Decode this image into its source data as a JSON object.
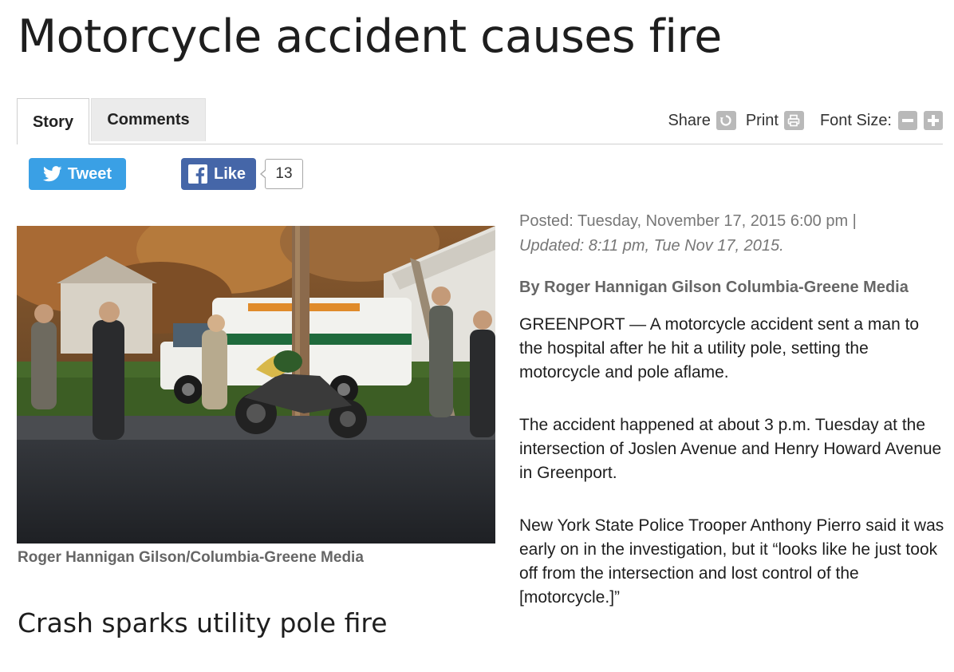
{
  "headline": "Motorcycle accident causes fire",
  "tabs": [
    {
      "label": "Story"
    },
    {
      "label": "Comments"
    }
  ],
  "toolbar": {
    "share_label": "Share",
    "print_label": "Print",
    "font_size_label": "Font Size:"
  },
  "social": {
    "tweet_label": "Tweet",
    "like_label": "Like",
    "like_count": "13"
  },
  "photo": {
    "caption": "Roger Hannigan Gilson/Columbia-Greene Media"
  },
  "subheadline": "Crash sparks utility pole fire",
  "article": {
    "posted": "Posted: Tuesday, November 17, 2015 6:00 pm |",
    "updated": "Updated: 8:11 pm, Tue Nov 17, 2015.",
    "byline": "By Roger Hannigan Gilson Columbia-Greene Media",
    "paragraphs": [
      "GREENPORT — A motorcycle accident sent a man to the hospital after he hit a utility pole, setting the motorcycle and pole aflame.",
      "The accident happened at about 3 p.m. Tuesday at the intersection of Joslen Avenue and Henry Howard Avenue in Greenport.",
      "New York State Police Trooper Anthony Pierro said it was early on in the investigation, but it “looks like he just took off from the intersection and lost control of the [motorcycle.]”"
    ]
  },
  "colors": {
    "twitter_blue": "#3aa0e5",
    "facebook_blue": "#4566a8",
    "icon_gray": "#b9b9b9",
    "tab_inactive": "#ebebeb",
    "caption_gray": "#666666"
  },
  "icons": [
    "twitter-bird-icon",
    "facebook-f-icon",
    "share-icon",
    "print-icon",
    "font-decrease-icon",
    "font-increase-icon"
  ]
}
